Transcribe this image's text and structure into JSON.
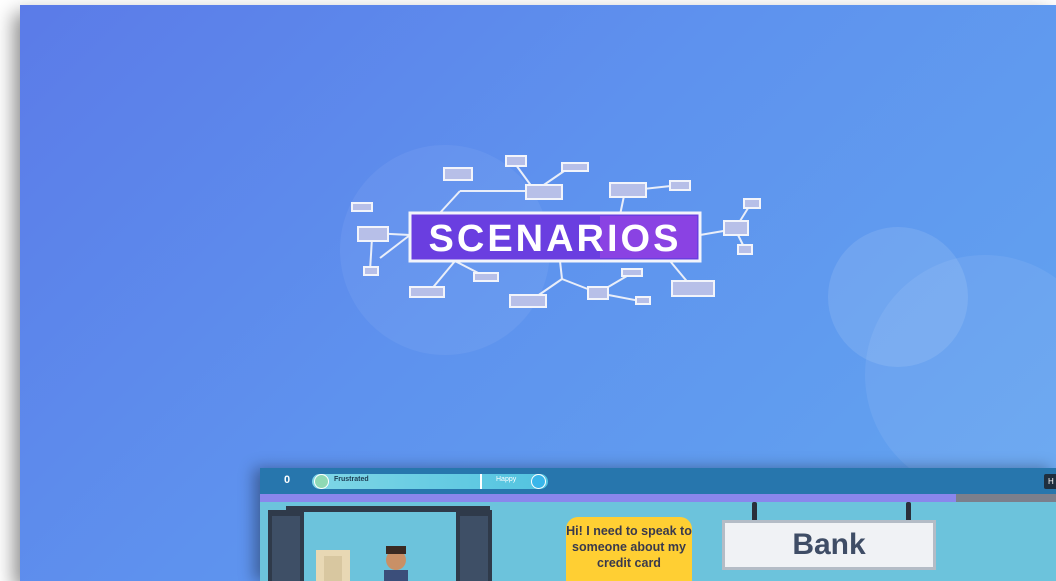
{
  "logo": {
    "text": "SCENARIOS"
  },
  "game": {
    "score": "0",
    "meter": {
      "left_label": "Frustrated",
      "right_label": "Happy"
    },
    "help_label": "H",
    "speech": "Hi! I need to speak to someone about my credit card",
    "sign": "Bank"
  },
  "colors": {
    "background": "#5e92ee",
    "banner": "#6a3ee0",
    "topbar": "#2776ad",
    "bubble": "#ffcf33"
  },
  "icons": [
    "frown-icon",
    "check-icon"
  ]
}
